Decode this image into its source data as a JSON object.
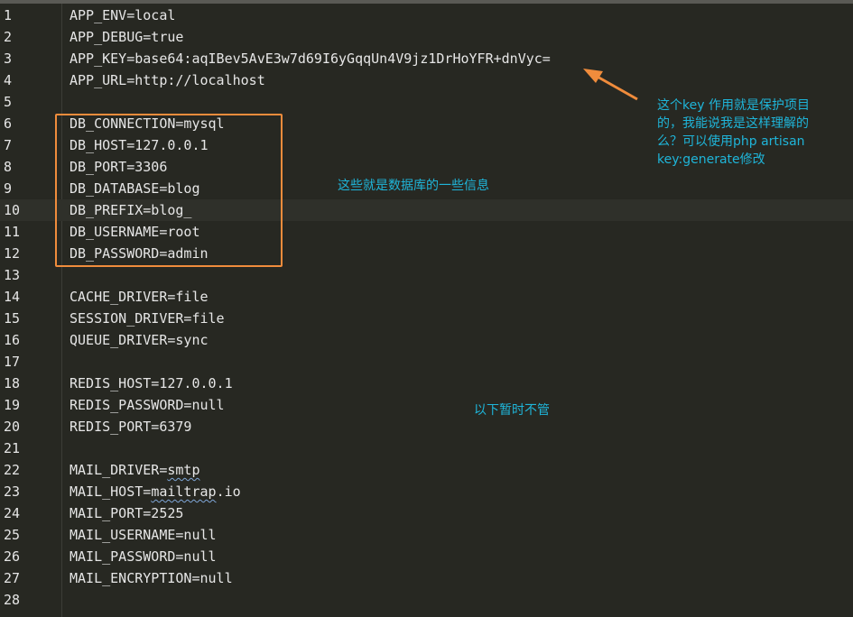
{
  "lines": [
    {
      "num": "1",
      "text": "APP_ENV=local"
    },
    {
      "num": "2",
      "text": "APP_DEBUG=true"
    },
    {
      "num": "3",
      "text": "APP_KEY=base64:aqIBev5AvE3w7d69I6yGqqUn4V9jz1DrHoYFR+dnVyc="
    },
    {
      "num": "4",
      "text": "APP_URL=http://localhost"
    },
    {
      "num": "5",
      "text": ""
    },
    {
      "num": "6",
      "text": "DB_CONNECTION=mysql"
    },
    {
      "num": "7",
      "text": "DB_HOST=127.0.0.1"
    },
    {
      "num": "8",
      "text": "DB_PORT=3306"
    },
    {
      "num": "9",
      "text": "DB_DATABASE=blog"
    },
    {
      "num": "10",
      "text": "DB_PREFIX=blog_"
    },
    {
      "num": "11",
      "text": "DB_USERNAME=root"
    },
    {
      "num": "12",
      "text": "DB_PASSWORD=admin"
    },
    {
      "num": "13",
      "text": ""
    },
    {
      "num": "14",
      "text": "CACHE_DRIVER=file"
    },
    {
      "num": "15",
      "text": "SESSION_DRIVER=file"
    },
    {
      "num": "16",
      "text": "QUEUE_DRIVER=sync"
    },
    {
      "num": "17",
      "text": ""
    },
    {
      "num": "18",
      "text": "REDIS_HOST=127.0.0.1"
    },
    {
      "num": "19",
      "text": "REDIS_PASSWORD=null"
    },
    {
      "num": "20",
      "text": "REDIS_PORT=6379"
    },
    {
      "num": "21",
      "text": ""
    },
    {
      "num": "22",
      "text_prefix": "MAIL_DRIVER=",
      "text_squiggle": "smtp"
    },
    {
      "num": "23",
      "text_prefix": "MAIL_HOST=",
      "text_squiggle": "mailtrap",
      "text_suffix": ".io"
    },
    {
      "num": "24",
      "text": "MAIL_PORT=2525"
    },
    {
      "num": "25",
      "text": "MAIL_USERNAME=null"
    },
    {
      "num": "26",
      "text": "MAIL_PASSWORD=null"
    },
    {
      "num": "27",
      "text": "MAIL_ENCRYPTION=null"
    },
    {
      "num": "28",
      "text": ""
    }
  ],
  "current_line": "10",
  "annotations": {
    "key_note": [
      "这个key 作用就是保护项目",
      "的，我能说我是这样理解的",
      "么？可以使用php artisan",
      "key:generate修改"
    ],
    "db_note": "这些就是数据库的一些信息",
    "ignore_note": "以下暂时不管"
  },
  "colors": {
    "background": "#272822",
    "text": "#e6e6e6",
    "annotation_text": "#1fb5d9",
    "highlight_box": "#f08c3c",
    "arrow": "#f08c3c"
  }
}
